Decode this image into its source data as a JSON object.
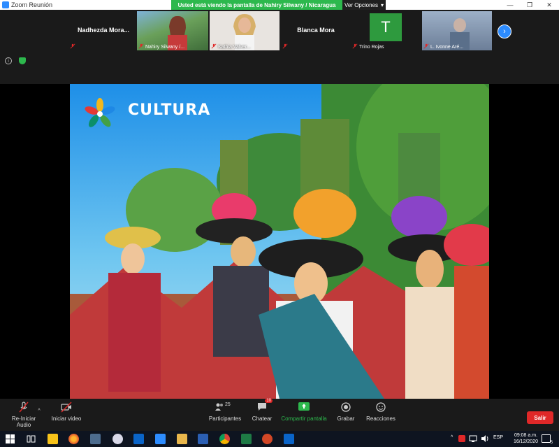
{
  "window": {
    "title": "Zoom Reunión",
    "controls": [
      "—",
      "❐",
      "✕"
    ]
  },
  "share_banner": {
    "text": "Usted está viendo la pantalla de Nahiry Silwany / Nicaragua",
    "view_options": "Ver Opciones"
  },
  "participants": [
    {
      "name": "Nadhezda  Mora...",
      "display": "big-name"
    },
    {
      "name": "Nahiry Silwany /...",
      "display": "video"
    },
    {
      "name": "Kathia Valver...",
      "display": "video"
    },
    {
      "name": "Blanca Mora",
      "display": "big-name"
    },
    {
      "name": "Trino Rojas",
      "display": "avatar",
      "initial": "T"
    },
    {
      "name": "L. Ivonne Aré...",
      "display": "video"
    }
  ],
  "slide": {
    "title": "CULTURA"
  },
  "toolbar": {
    "audio": "Re-Iniciar Audio",
    "video": "Iniciar video",
    "participants": "Participantes",
    "participants_count": "25",
    "chat": "Chatear",
    "chat_badge": "10",
    "share": "Compartir pantalla",
    "record": "Grabar",
    "reactions": "Reacciones",
    "leave": "Salir"
  },
  "taskbar": {
    "language": "ESP",
    "time": "09:08 a.m.",
    "date": "16/12/2020",
    "notification_count": "5"
  },
  "colors": {
    "accent": "#2d8cff",
    "share_green": "#2db84d",
    "leave_red": "#e02828"
  }
}
